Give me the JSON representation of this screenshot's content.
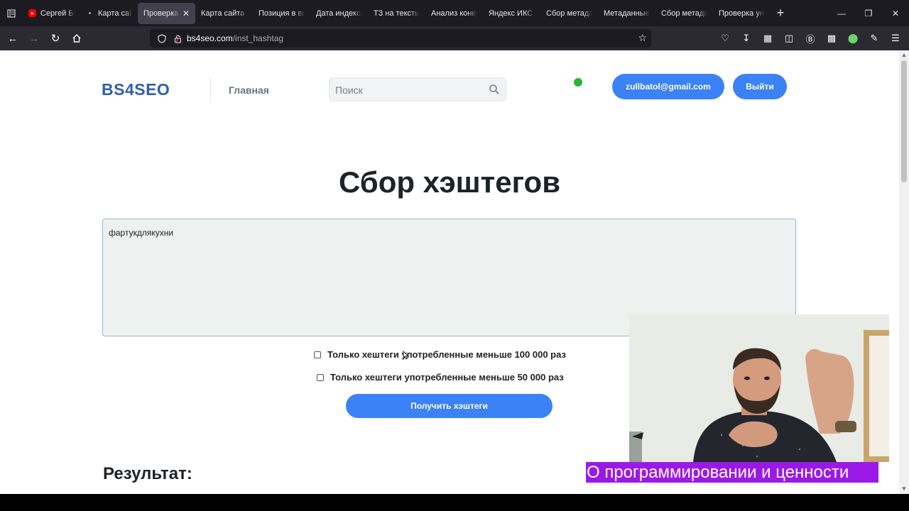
{
  "browser": {
    "tabs": [
      {
        "label": "Сергей Бо",
        "favicon": "youtube-icon",
        "active": false
      },
      {
        "label": "Карта сайт",
        "favicon": "dot-icon",
        "active": false
      },
      {
        "label": "Проверка н",
        "favicon": "",
        "active": true
      },
      {
        "label": "Карта сайта |",
        "favicon": "",
        "active": false
      },
      {
        "label": "Позиция в вы",
        "favicon": "",
        "active": false
      },
      {
        "label": "Дата индекса",
        "favicon": "",
        "active": false
      },
      {
        "label": "ТЗ на тексты",
        "favicon": "",
        "active": false
      },
      {
        "label": "Анализ конку",
        "favicon": "",
        "active": false
      },
      {
        "label": "Яндекс ИКС |",
        "favicon": "",
        "active": false
      },
      {
        "label": "Сбор метада",
        "favicon": "",
        "active": false
      },
      {
        "label": "Метаданные",
        "favicon": "",
        "active": false
      },
      {
        "label": "Сбор метада",
        "favicon": "",
        "active": false
      },
      {
        "label": "Проверка уни",
        "favicon": "",
        "active": false
      }
    ],
    "url_host": "bs4seo.com",
    "url_path": "/inst_hashtag"
  },
  "header": {
    "logo": "BS4SEO",
    "nav_main": "Главная",
    "search_placeholder": "Поиск",
    "email_button": "zullbatol@gmail.com",
    "logout_button": "Выйти",
    "status_color": "#2ab33a"
  },
  "main": {
    "title": "Сбор хэштегов",
    "textarea_value": "фартукдлякухни",
    "options": [
      "Только хештеги употребленные меньше 100 000 раз",
      "Только хештеги употребленные меньше 50 000 раз"
    ],
    "submit_button": "Получить хэштеги",
    "result_heading": "Результат:"
  },
  "overlay": {
    "caption": "О программировании и ценности"
  },
  "colors": {
    "accent": "#3b82f6",
    "logo": "#2f5fae",
    "caption_bg": "#9b19e6"
  }
}
